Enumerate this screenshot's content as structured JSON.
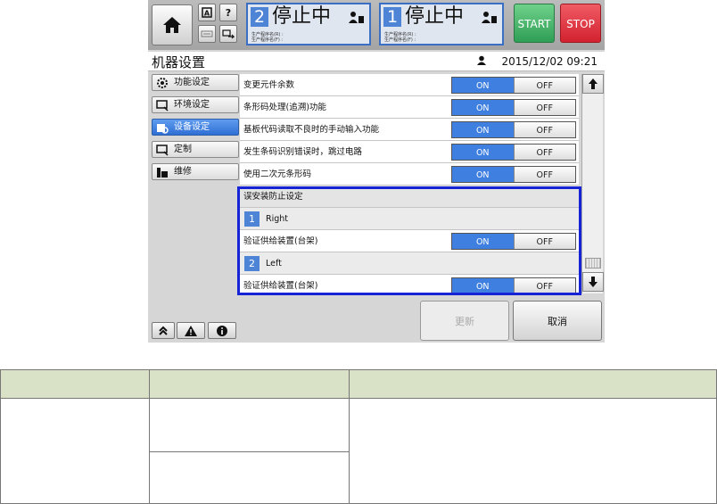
{
  "header": {
    "lanes": [
      {
        "number": "2",
        "state": "停止中",
        "info_line1": "生产程序名(R) :",
        "info_line2": "生产程序名(F) :"
      },
      {
        "number": "1",
        "state": "停止中",
        "info_line1": "生产程序名(R) :",
        "info_line2": "生产程序名(F) :"
      }
    ],
    "start_label": "START",
    "stop_label": "STOP",
    "help_label": "?"
  },
  "titlebar": {
    "title": "机器设置",
    "datetime": "2015/12/02 09:21"
  },
  "sidebar": {
    "items": [
      {
        "label": "功能设定",
        "icon": "gear-icon"
      },
      {
        "label": "环境设定",
        "icon": "monitor-icon"
      },
      {
        "label": "设备设定",
        "icon": "device-icon",
        "active": true
      },
      {
        "label": "定制",
        "icon": "monitor-icon"
      },
      {
        "label": "维修",
        "icon": "tools-icon"
      }
    ]
  },
  "settings": {
    "rows": [
      {
        "label": "变更元件余数",
        "on": "ON",
        "off": "OFF"
      },
      {
        "label": "条形码处理(追溯)功能",
        "on": "ON",
        "off": "OFF"
      },
      {
        "label": "基板代码读取不良时的手动输入功能",
        "on": "ON",
        "off": "OFF"
      },
      {
        "label": "发生条码识别错误时，跳过电路",
        "on": "ON",
        "off": "OFF"
      },
      {
        "label": "使用二次元条形码",
        "on": "ON",
        "off": "OFF"
      }
    ],
    "section_title": "误安装防止设定",
    "lanes": [
      {
        "number": "1",
        "name": "Right",
        "setting_label": "验证供给装置(台架)",
        "on": "ON",
        "off": "OFF"
      },
      {
        "number": "2",
        "name": "Left",
        "setting_label": "验证供给装置(台架)",
        "on": "ON",
        "off": "OFF"
      }
    ]
  },
  "footer": {
    "update_label": "更新",
    "cancel_label": "取消"
  },
  "colors": {
    "accent": "#3f7fe0",
    "highlight_border": "#1623d6",
    "start": "#2f9e56",
    "stop": "#d2222f",
    "table_header": "#d9e2c7"
  }
}
